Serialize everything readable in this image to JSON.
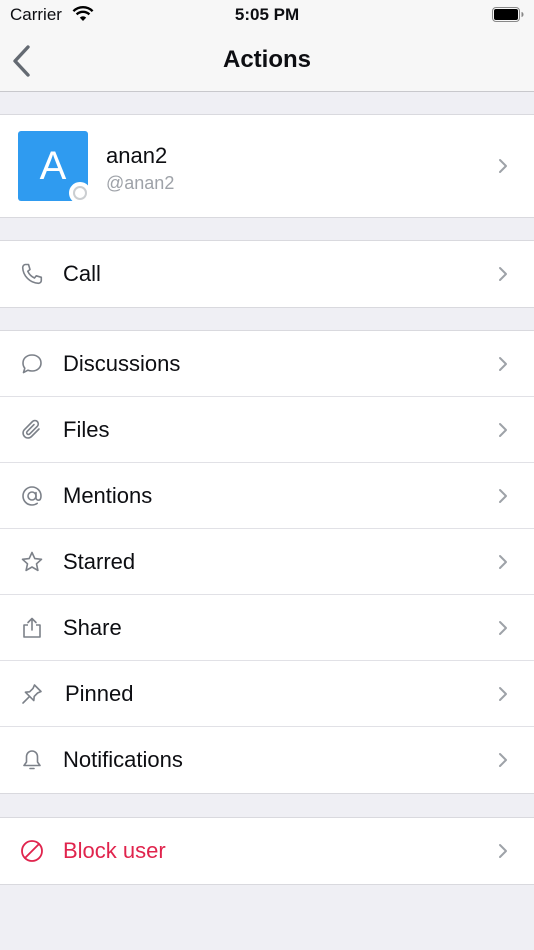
{
  "status_bar": {
    "carrier": "Carrier",
    "time": "5:05 PM"
  },
  "nav": {
    "title": "Actions",
    "back_icon": "chevron-left-icon"
  },
  "profile": {
    "avatar_letter": "A",
    "name": "anan2",
    "handle": "@anan2",
    "avatar_color": "#2f9bf0"
  },
  "call_group": [
    {
      "label": "Call",
      "icon": "phone-icon"
    }
  ],
  "actions": [
    {
      "label": "Discussions",
      "icon": "discussion-icon"
    },
    {
      "label": "Files",
      "icon": "paperclip-icon"
    },
    {
      "label": "Mentions",
      "icon": "at-icon"
    },
    {
      "label": "Starred",
      "icon": "star-icon"
    },
    {
      "label": "Share",
      "icon": "share-icon"
    },
    {
      "label": "Pinned",
      "icon": "pin-icon"
    },
    {
      "label": "Notifications",
      "icon": "bell-icon"
    }
  ],
  "danger_group": [
    {
      "label": "Block user",
      "icon": "block-icon"
    }
  ],
  "colors": {
    "danger": "#e0244d",
    "icon": "#7c8189",
    "chevron": "#9ea2a8"
  }
}
